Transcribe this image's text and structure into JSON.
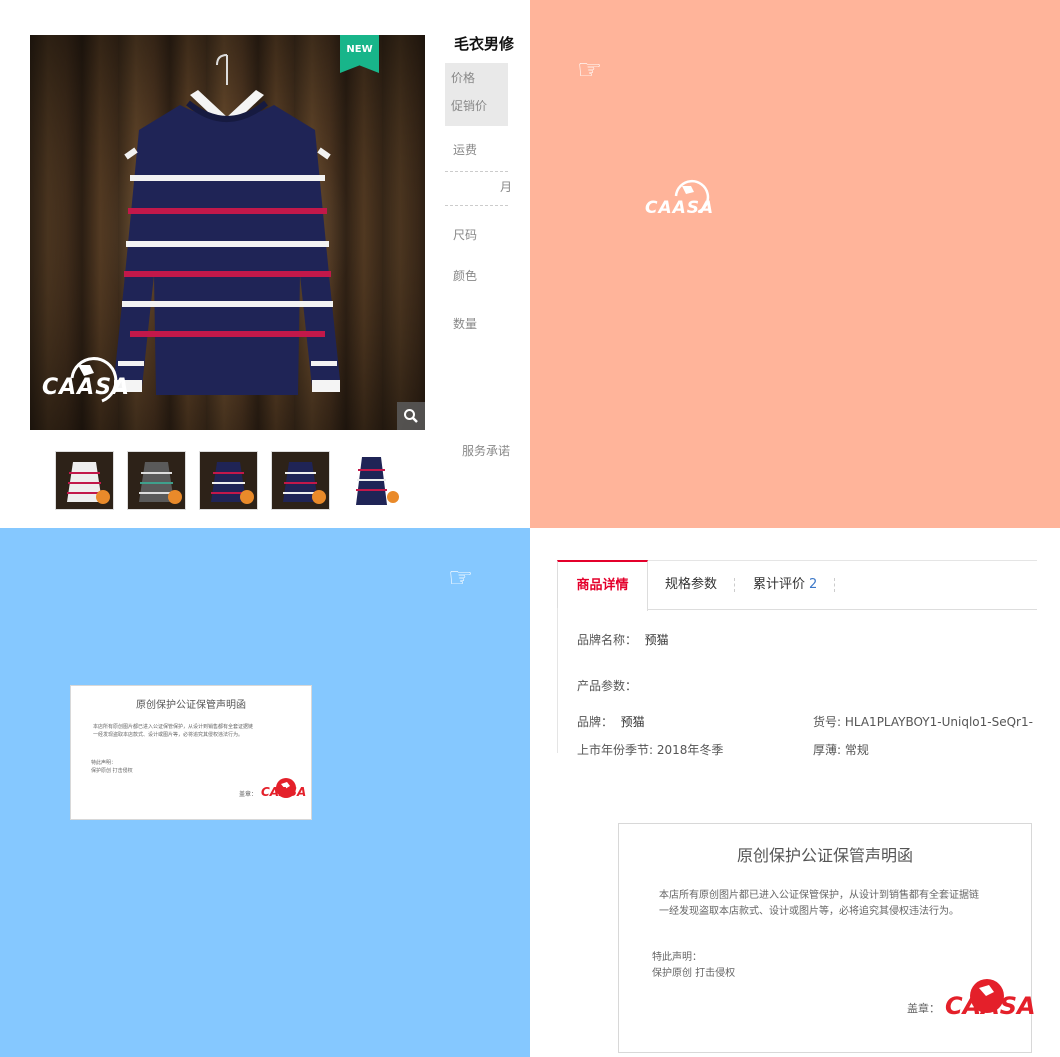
{
  "product": {
    "title": "毛衣男修",
    "badge": "NEW",
    "brand_logo": "CAASA",
    "labels": {
      "price": "价格",
      "promo_price": "促销价",
      "shipping": "运费",
      "monthly_sales_fragment": "月",
      "size": "尺码",
      "color": "颜色",
      "quantity": "数量",
      "service": "服务承诺"
    },
    "thumbnails": [
      "white-red-striped",
      "grey-striped",
      "navy-red-striped",
      "navy-white-striped",
      "navy-red-striped-small"
    ],
    "colors": {
      "sweater_navy": "#1f2456",
      "stripe_red": "#c2184a",
      "stripe_white": "#f2f2f2",
      "badge_green": "#18b58a"
    }
  },
  "panels": {
    "salmon_bg": "#ffb49a",
    "blue_bg": "#85c8ff",
    "hand_icon": "pointing-hand-icon",
    "logo": "CAASA"
  },
  "certificate": {
    "title": "原创保护公证保管声明函",
    "line1": "本店所有原创图片都已进入公证保管保护，从设计到销售都有全套证据链",
    "line2": "一经发现盗取本店款式、设计或图片等，必将追究其侵权违法行为。",
    "statement": "特此声明：",
    "slogan": "保护原创  打击侵权",
    "seal_label": "盖章：",
    "logo": "CAASA",
    "logo_color": "#e4202a"
  },
  "details": {
    "tabs": [
      {
        "label": "商品详情"
      },
      {
        "label": "规格参数"
      },
      {
        "label": "累计评价",
        "count": "2"
      }
    ],
    "brand_name_label": "品牌名称：",
    "brand_name_value": "预猫",
    "params_label": "产品参数：",
    "brand_label": "品牌：",
    "brand_value": "预猫",
    "sku_label": "货号: ",
    "sku_value": "HLA1PLAYBOY1-Uniqlo1-SeQr1-...",
    "season_label": "上市年份季节: ",
    "season_value": "2018年冬季",
    "thickness_label": "厚薄: ",
    "thickness_value": "常规",
    "accent": "#e4002b"
  }
}
